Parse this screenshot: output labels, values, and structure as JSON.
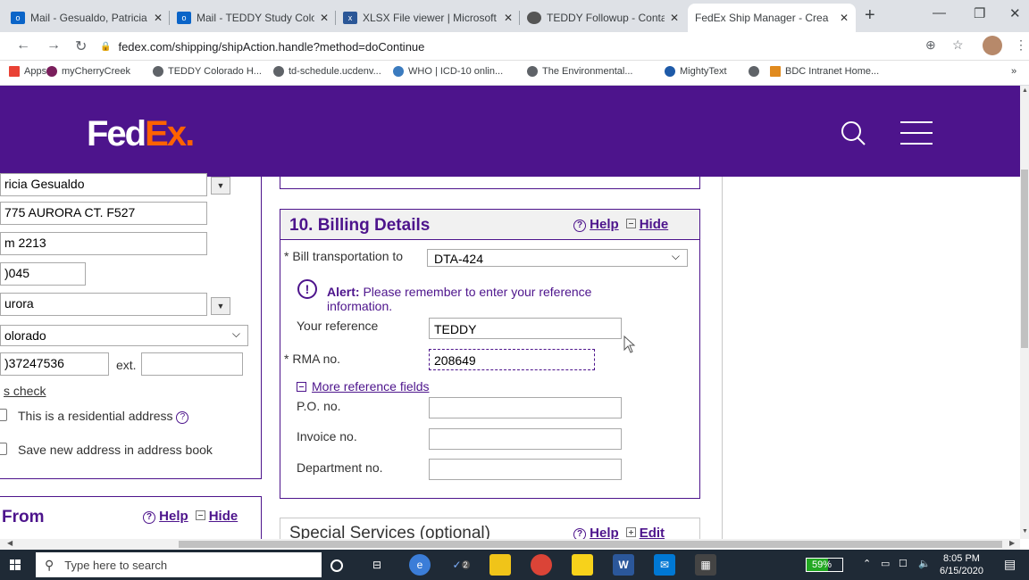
{
  "browser": {
    "tabs": [
      {
        "label": "Mail - Gesualdo, Patricia - C",
        "icon": "outlook-icon",
        "color": "#0a64c8"
      },
      {
        "label": "Mail - TEDDY Study Colorad",
        "icon": "outlook-icon",
        "color": "#0a64c8"
      },
      {
        "label": "XLSX File viewer | Microsoft",
        "icon": "xlsx-icon",
        "color": "#2b5797"
      },
      {
        "label": "TEDDY Followup - Contact",
        "icon": "globe-icon",
        "color": "#555"
      },
      {
        "label": "FedEx Ship Manager - Crea",
        "icon": "fedex-icon",
        "color": "#4d148c"
      }
    ],
    "new_tab": "+",
    "url": "fedex.com/shipping/shipAction.handle?method=doContinue",
    "bookmarks": [
      {
        "label": "Apps",
        "color": "#e94235"
      },
      {
        "label": "myCherryCreek",
        "color": "#7a1e5c"
      },
      {
        "label": "TEDDY Colorado H...",
        "color": "#5f6368"
      },
      {
        "label": "td-schedule.ucdenv...",
        "color": "#5f6368"
      },
      {
        "label": "WHO | ICD-10 onlin...",
        "color": "#3b7bbf"
      },
      {
        "label": "The Environmental...",
        "color": "#5f6368"
      },
      {
        "label": "MightyText",
        "color": "#1e5aa8"
      },
      {
        "label": "",
        "color": "#5f6368"
      },
      {
        "label": "BDC Intranet Home...",
        "color": "#e08a1e"
      }
    ],
    "more": "»"
  },
  "header": {
    "logo_fed": "Fed",
    "logo_ex": "Ex",
    "logo_dot": "."
  },
  "recipient": {
    "name": "ricia Gesualdo",
    "address1": "775 AURORA CT.  F527",
    "address2": "m 2213",
    "zip": ")045",
    "city": "urora",
    "state": "olorado",
    "phone": ")37247536",
    "ext_label": "ext.",
    "ext_value": "",
    "address_check_link": "s check",
    "residential_label": "This is a residential address",
    "save_label": "Save new address in address book"
  },
  "from_section": {
    "title": "From",
    "help": "Help",
    "hide": "Hide"
  },
  "billing": {
    "title": "10. Billing Details",
    "help": "Help",
    "hide": "Hide",
    "bill_to_label": "Bill transportation to",
    "bill_to_value": "DTA-424",
    "alert_strong": "Alert:",
    "alert_line1": "Please remember to enter your reference",
    "alert_line2": "information.",
    "your_reference_label": "Your reference",
    "your_reference_value": "TEDDY",
    "rma_label": "RMA no.",
    "rma_value": "208649",
    "more_fields_link": "More reference fields",
    "po_label": "P.O. no.",
    "invoice_label": "Invoice no.",
    "department_label": "Department no.",
    "required_mark": "*"
  },
  "special_services": {
    "title": "Special Services (optional)",
    "help": "Help",
    "edit": "Edit"
  },
  "taskbar": {
    "search_placeholder": "Type here to search",
    "battery": "59%",
    "battery_level": 0.59,
    "time": "8:05 PM",
    "date": "6/15/2020",
    "todo_badge": "2"
  }
}
